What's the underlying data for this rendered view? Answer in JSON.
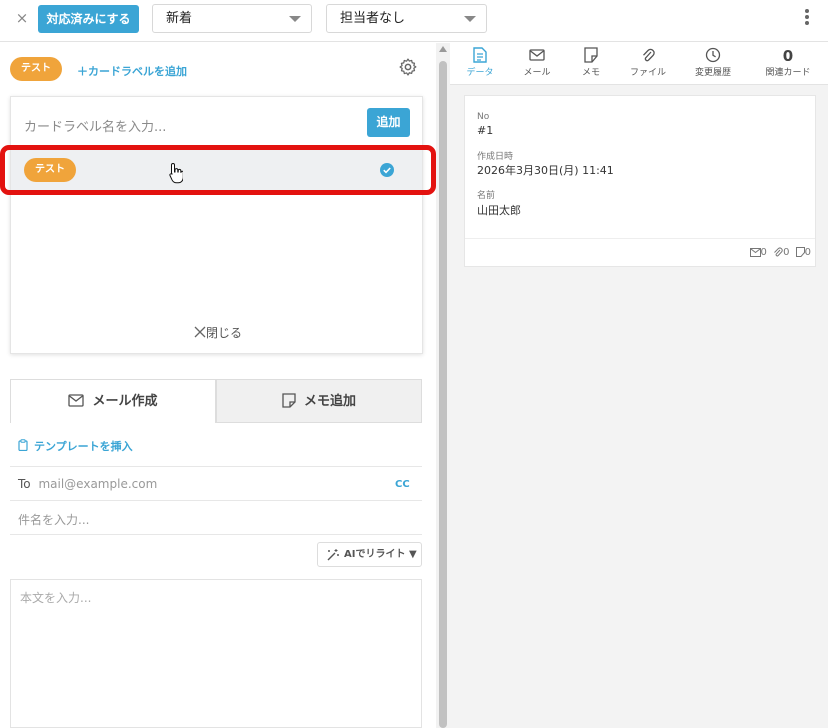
{
  "topbar": {
    "close_icon": "×",
    "done_button": "対応済みにする",
    "status_select": "新着",
    "assignee_select": "担当者なし"
  },
  "labels": {
    "current_label": "テスト",
    "add_label_link": "＋カードラベルを追加",
    "popup": {
      "input_placeholder": "カードラベル名を入力...",
      "add_button": "追加",
      "row_label": "テスト",
      "close_label": "閉じる"
    }
  },
  "composer": {
    "tabs": [
      {
        "label": "メール作成",
        "icon": "mail-icon"
      },
      {
        "label": "メモ追加",
        "icon": "memo-icon"
      }
    ],
    "template_link": "テンプレートを挿入",
    "to_label": "To",
    "to_placeholder": "mail@example.com",
    "cc_link": "CC",
    "subject_placeholder": "件名を入力...",
    "ai_button": "AIでリライト ▼",
    "body_placeholder": "本文を入力..."
  },
  "detail": {
    "tabs": [
      {
        "label": "データ",
        "icon": "document-icon"
      },
      {
        "label": "メール",
        "icon": "mail-icon"
      },
      {
        "label": "メモ",
        "icon": "memo-icon"
      },
      {
        "label": "ファイル",
        "icon": "paperclip-icon"
      },
      {
        "label": "変更履歴",
        "icon": "clock-icon"
      },
      {
        "label": "関連カード",
        "count": "0"
      }
    ],
    "fields": [
      {
        "label": "No",
        "value": "#1"
      },
      {
        "label": "作成日時",
        "value": "2026年3月30日(月) 11:41"
      },
      {
        "label": "名前",
        "value": "山田太郎"
      }
    ],
    "counts": {
      "mail": "0",
      "file": "0",
      "memo": "0"
    }
  },
  "colors": {
    "accent": "#3ba5d5",
    "label_orange": "#f0a43b",
    "highlight_red": "#e3120f"
  }
}
